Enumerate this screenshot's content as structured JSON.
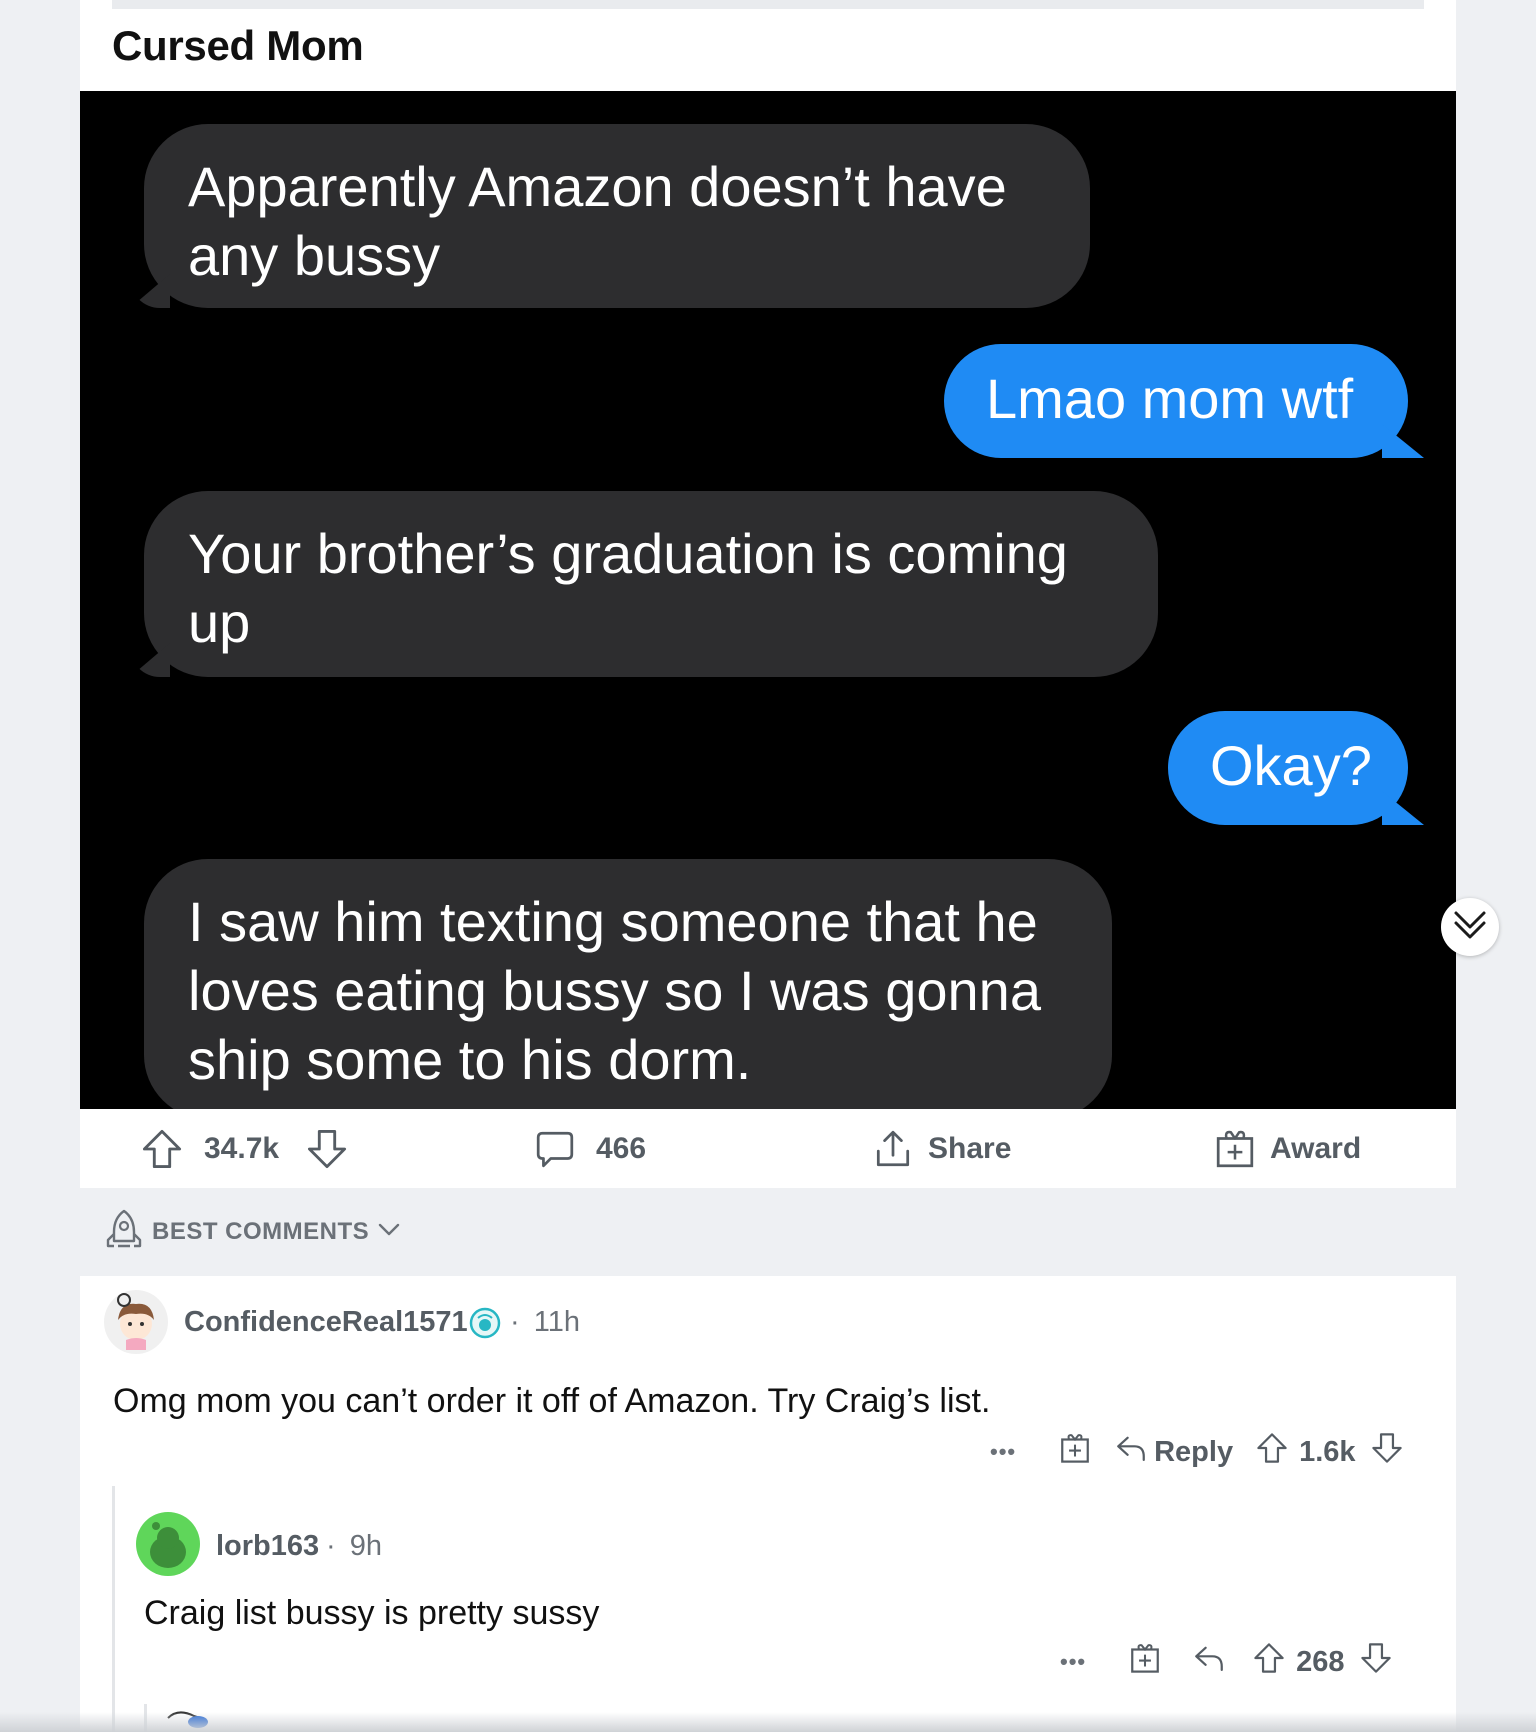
{
  "post": {
    "title": "Cursed Mom",
    "messages": [
      {
        "side": "recv",
        "text_lines": [
          "Apparently Amazon doesn’t have",
          "any bussy"
        ]
      },
      {
        "side": "sent",
        "text_lines": [
          "Lmao mom wtf"
        ]
      },
      {
        "side": "recv",
        "text_lines": [
          "Your brother’s graduation is coming",
          "up"
        ]
      },
      {
        "side": "sent",
        "text_lines": [
          "Okay?"
        ]
      },
      {
        "side": "recv",
        "text_lines": [
          "I saw him texting someone that he",
          "loves eating bussy so I was gonna",
          "ship some to his dorm."
        ]
      }
    ],
    "upvotes": "34.7k",
    "comment_count": "466",
    "share_label": "Share",
    "award_label": "Award"
  },
  "sort": {
    "label": "BEST COMMENTS"
  },
  "comments": [
    {
      "username": "ConfidenceReal1571",
      "age": "11h",
      "body": "Omg mom you can’t order it off of Amazon. Try Craig’s list.",
      "reply_label": "Reply",
      "score": "1.6k",
      "more": "•••"
    },
    {
      "username": "lorb163",
      "age": "9h",
      "body": "Craig list bussy is pretty sussy",
      "score": "268",
      "more": "•••"
    }
  ],
  "colors": {
    "accent_blue": "#1f8bf4",
    "bubble_gray": "#2d2d2f",
    "meta_gray": "#6b7178"
  }
}
